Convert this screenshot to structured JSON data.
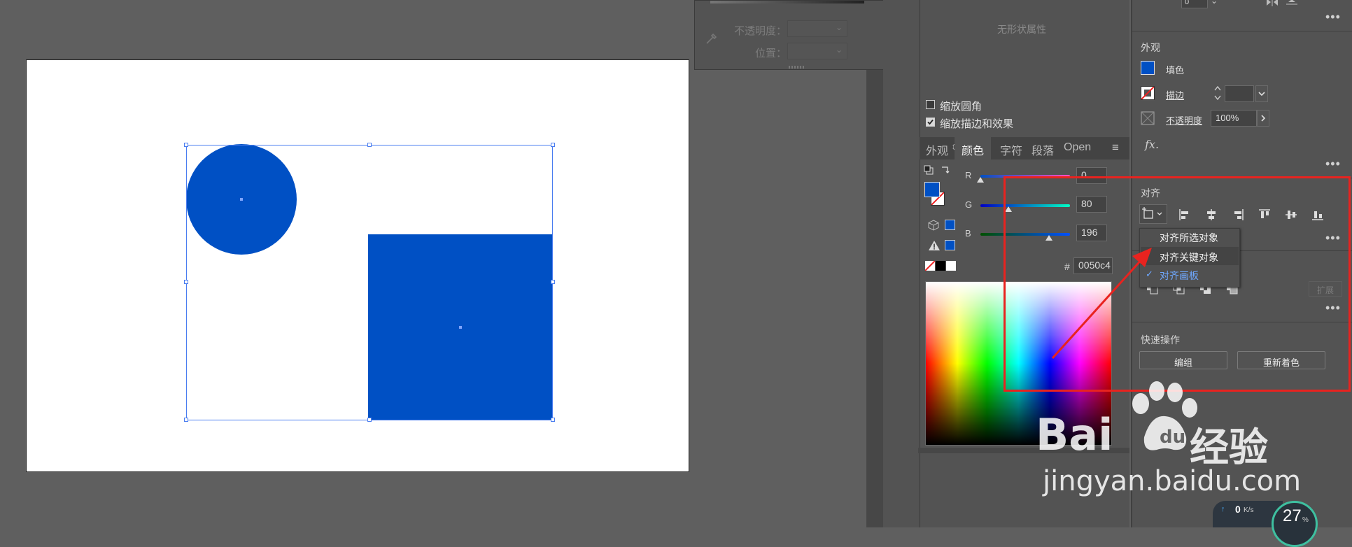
{
  "gradient_panel": {
    "opacity_label": "不透明度：",
    "position_label": "位置："
  },
  "shape_properties": {
    "no_props": "无形状属性",
    "scale_corners": "缩放圆角",
    "scale_corners_checked": false,
    "scale_strokes": "缩放描边和效果",
    "scale_strokes_checked": true
  },
  "color_panel": {
    "tabs": [
      "外观",
      "颜色",
      "字符",
      "段落",
      "Open"
    ],
    "active_tab": "颜色",
    "channels": [
      {
        "label": "R",
        "value": "0"
      },
      {
        "label": "G",
        "value": "80"
      },
      {
        "label": "B",
        "value": "196"
      }
    ],
    "hex_label": "#",
    "hex_value": "0050c4",
    "fill_color": "#0050c4"
  },
  "right_panel": {
    "top_value": "0",
    "appearance": {
      "title": "外观",
      "fill_label": "填色",
      "stroke_label": "描边",
      "opacity_label": "不透明度",
      "opacity_value": "100%",
      "fx_label": "fx."
    },
    "align": {
      "title": "对齐",
      "menu": [
        "对齐所选对象",
        "对齐关键对象",
        "对齐画板"
      ],
      "checked_item": "对齐画板"
    },
    "expand_label": "扩展",
    "quick_actions": {
      "title": "快速操作",
      "group_button": "编组",
      "recolor_button": "重新着色"
    }
  },
  "watermark": {
    "brand": "Bai",
    "brand_cn": "经验",
    "url": "jingyan.baidu.com"
  },
  "net_widget": {
    "upload": "0",
    "unit": "K/s",
    "percent": "27",
    "percent_sign": "%"
  },
  "colors": {
    "shape_fill": "#0050c4",
    "selection": "#4a7df0",
    "annotation": "#e8231f"
  }
}
